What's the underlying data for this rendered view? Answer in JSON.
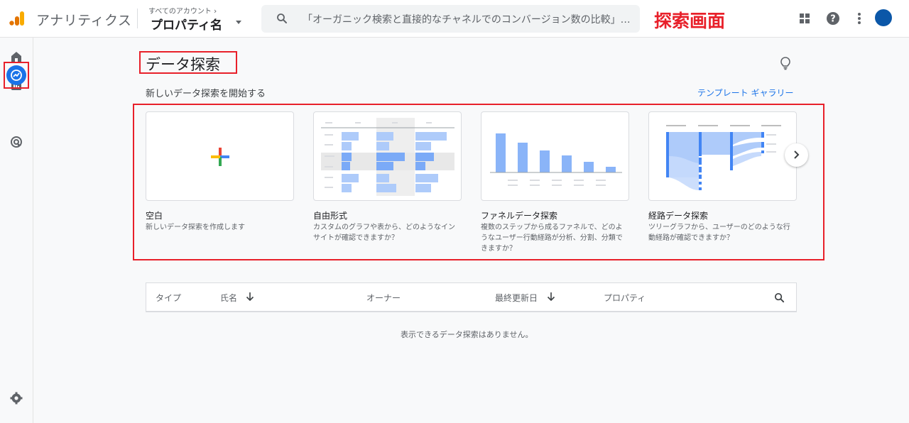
{
  "header": {
    "app_title": "アナリティクス",
    "account_label": "すべてのアカウント",
    "property_name": "プロパティ名",
    "search_placeholder": "「オーガニック検索と直接的なチャネルでのコンバージョン数の比較」と検...",
    "annotation": "探索画面",
    "icons": [
      "apps-grid-icon",
      "help-icon",
      "more-vert-icon",
      "avatar"
    ]
  },
  "rail": {
    "items": [
      "home-icon",
      "reports-icon",
      "explore-icon",
      "advertising-icon",
      "settings-icon"
    ],
    "active": "explore-icon"
  },
  "page": {
    "title": "データ探索",
    "section_label": "新しいデータ探索を開始する",
    "template_link": "テンプレート ギャラリー"
  },
  "cards": [
    {
      "title": "空白",
      "desc": "新しいデータ探索を作成します"
    },
    {
      "title": "自由形式",
      "desc": "カスタムのグラフや表から、どのようなインサイトが確認できますか？"
    },
    {
      "title": "ファネルデータ探索",
      "desc": "複数のステップから成るファネルで、どのようなユーザー行動経路が分析、分割、分類できますか？"
    },
    {
      "title": "経路データ探索",
      "desc": "ツリーグラフから、ユーザーのどのような行動経路が確認できますか？"
    }
  ],
  "table": {
    "columns": [
      "タイプ",
      "氏名",
      "オーナー",
      "最終更新日",
      "プロパティ"
    ],
    "sorted_columns": [
      "氏名",
      "最終更新日"
    ],
    "empty_message": "表示できるデータ探索はありません。"
  },
  "colors": {
    "accent": "#1a73e8",
    "annotation_red": "#e8202a",
    "bar_light": "#aecbfa",
    "bar_dark": "#8ab4f8"
  }
}
